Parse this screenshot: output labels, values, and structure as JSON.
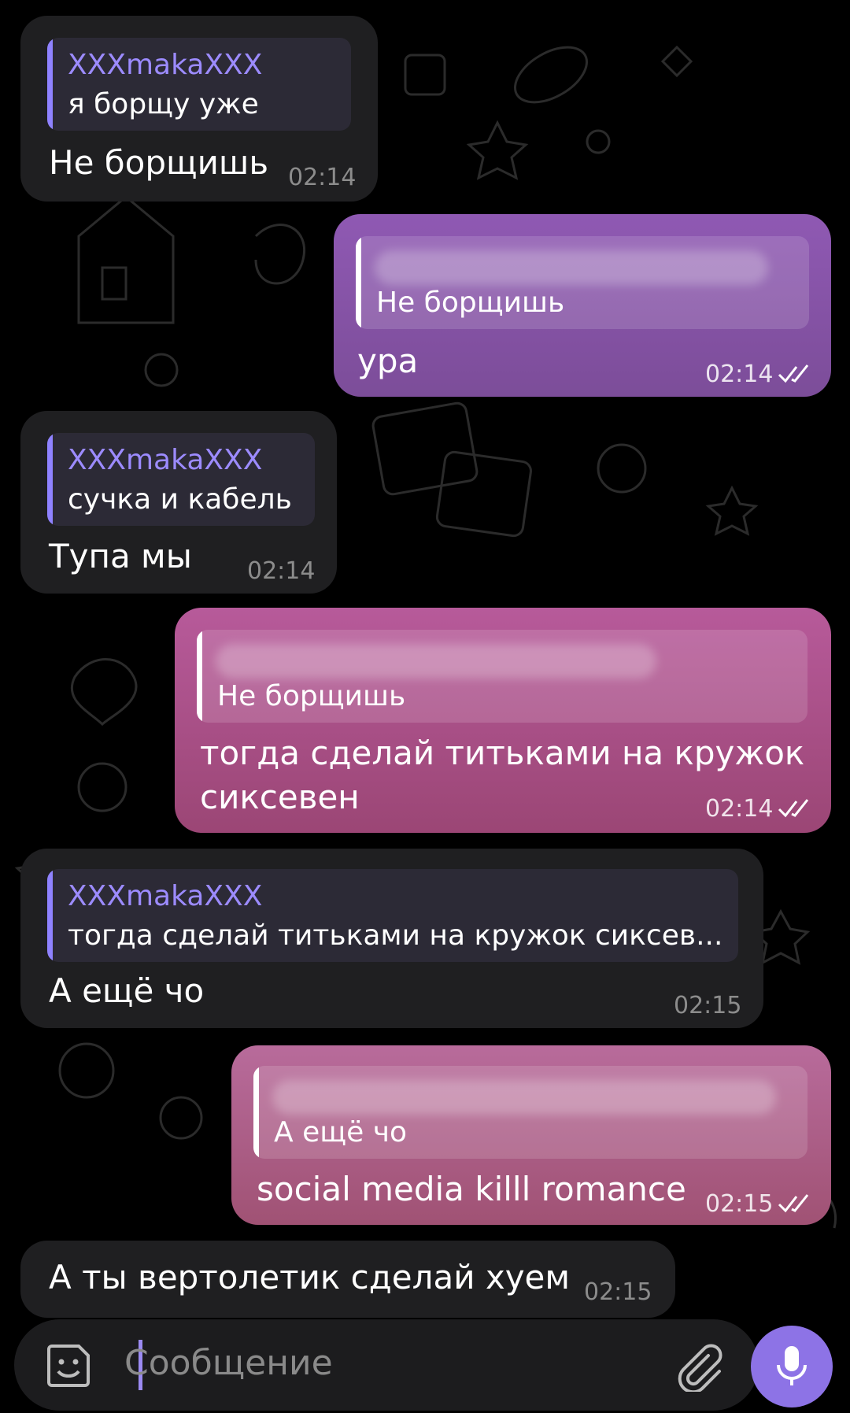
{
  "messages": [
    {
      "direction": "incoming",
      "quote_author": "XXXmakaXXX",
      "quote_text": "я борщу уже",
      "text": "Не борщишь",
      "time": "02:14"
    },
    {
      "direction": "outgoing",
      "quote_text": "Не борщишь",
      "text": "ура",
      "time": "02:14"
    },
    {
      "direction": "incoming",
      "quote_author": "XXXmakaXXX",
      "quote_text": "сучка и кабель",
      "text": "Тупа мы",
      "time": "02:14"
    },
    {
      "direction": "outgoing",
      "quote_text": "Не борщишь",
      "text_line1": "тогда сделай титьками на кружок",
      "text_line2": "сиксевен",
      "time": "02:14"
    },
    {
      "direction": "incoming",
      "quote_author": "XXXmakaXXX",
      "quote_text": "тогда сделай титьками на кружок сиксев...",
      "text": "А ещё чо",
      "time": "02:15"
    },
    {
      "direction": "outgoing",
      "quote_text": "А ещё чо",
      "text": "social media killl romance",
      "time": "02:15"
    },
    {
      "direction": "incoming",
      "text": "А ты вертолетик сделай хуем",
      "time": "02:15"
    }
  ],
  "composer": {
    "placeholder": "Сообщение",
    "emoji_icon": "sticker-smile-icon",
    "attach_icon": "paperclip-icon",
    "mic_icon": "microphone-icon"
  },
  "colors": {
    "background": "#000000",
    "incoming_bubble": "#1f1f21",
    "outgoing_purple": "#8a56ad",
    "outgoing_pink": "#ad4f8a",
    "quote_author": "#9c8bff",
    "accent": "#8d73e6"
  }
}
